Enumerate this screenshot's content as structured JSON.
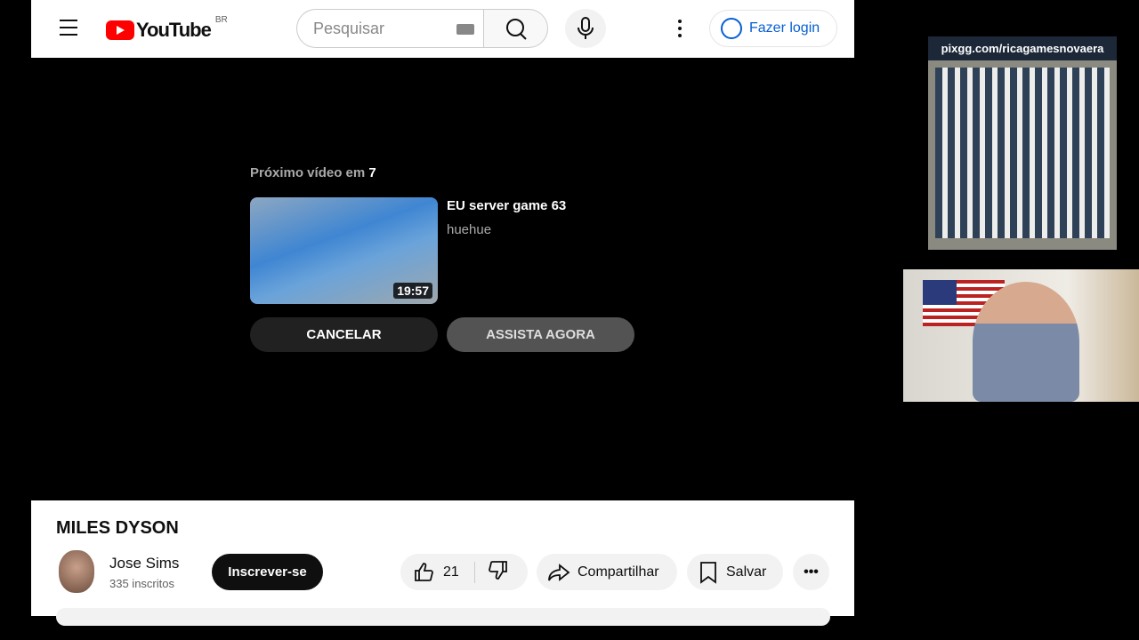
{
  "header": {
    "logo": "YouTube",
    "region": "BR",
    "search_placeholder": "Pesquisar",
    "login": "Fazer login"
  },
  "endscreen": {
    "next_label": "Próximo vídeo em",
    "countdown": "7",
    "video_title": "EU server game 63",
    "channel": "huehue",
    "duration": "19:57",
    "cancel": "CANCELAR",
    "watch_now": "ASSISTA AGORA"
  },
  "video": {
    "title": "MILES DYSON",
    "channel": "Jose Sims",
    "subscribers": "335 inscritos",
    "subscribe": "Inscrever-se",
    "likes": "21",
    "share": "Compartilhar",
    "save": "Salvar",
    "more": "•••"
  },
  "overlay": {
    "qr_url": "pixgg.com/ricagamesnovaera"
  }
}
